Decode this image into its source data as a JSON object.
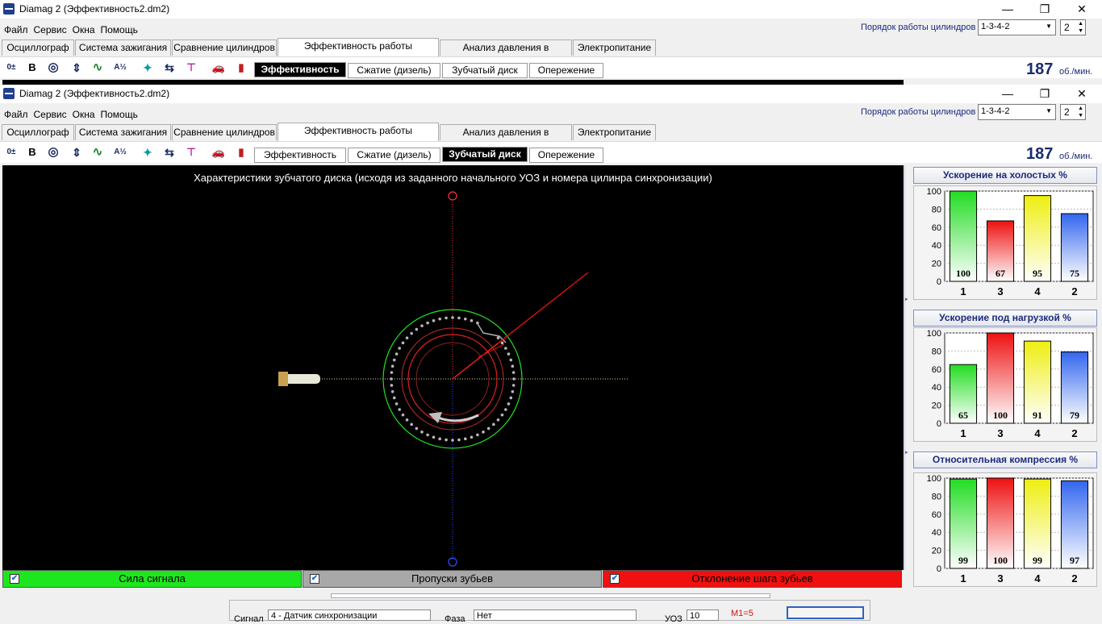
{
  "window_back": {
    "title": "Diamag 2 (Эффективность2.dm2)",
    "menu": [
      "Файл",
      "Сервис",
      "Окна",
      "Помощь"
    ],
    "cylinder_order_label": "Порядок работы цилиндров",
    "cylinder_order_value": "1-3-4-2",
    "cylinder_count": "2",
    "tabs": [
      "Осциллограф",
      "Система зажигания",
      "Сравнение цилиндров",
      "Эффективность работы цилиндров",
      "Анализ давления в цилиндре",
      "Электропитание"
    ],
    "active_tab": 3,
    "subtabs": [
      "Эффективность",
      "Сжатие (дизель)",
      "Зубчатый диск",
      "Опережение"
    ],
    "active_subtab": 0,
    "rpm": "187",
    "rpm_unit": "об./мин."
  },
  "window_front": {
    "title": "Diamag 2 (Эффективность2.dm2)",
    "menu": [
      "Файл",
      "Сервис",
      "Окна",
      "Помощь"
    ],
    "cylinder_order_label": "Порядок работы цилиндров",
    "cylinder_order_value": "1-3-4-2",
    "cylinder_count": "2",
    "tabs": [
      "Осциллограф",
      "Система зажигания",
      "Сравнение цилиндров",
      "Эффективность работы цилиндров",
      "Анализ давления в цилиндре",
      "Электропитание"
    ],
    "active_tab": 3,
    "subtabs": [
      "Эффективность",
      "Сжатие (дизель)",
      "Зубчатый диск",
      "Опережение"
    ],
    "active_subtab": 2,
    "rpm": "187",
    "rpm_unit": "об./мин."
  },
  "toolbar_icons": [
    "zero-offset-icon",
    "bold-icon",
    "rpm-gauge-icon",
    "scale-icon",
    "waveform-icon",
    "algorithm-icon",
    "sensor-icon",
    "numbering-icon",
    "filter-icon",
    "car-icon",
    "bars-icon"
  ],
  "toolbar_icon_glyphs": [
    "0±",
    "B",
    "◎",
    "⇕",
    "∿",
    "A½",
    "✦",
    "⇆",
    "⊤",
    "🚗",
    "▮"
  ],
  "canvas": {
    "title": "Характеристики зубчатого диска (исходя из заданного начального УОЗ и номера цилинра синхронизации)"
  },
  "legend": [
    {
      "label": "Сила сигнала",
      "color": "#1ee61e",
      "checked": true
    },
    {
      "label": "Пропуски зубьев",
      "color": "#a8a8a8",
      "checked": true
    },
    {
      "label": "Отклонение шага зубьев",
      "color": "#f01010",
      "checked": true
    }
  ],
  "chart_data": [
    {
      "type": "bar",
      "title": "Ускорение на холостых %",
      "categories": [
        "1",
        "3",
        "4",
        "2"
      ],
      "values": [
        100,
        67,
        95,
        75
      ],
      "colors": [
        "#22dd22",
        "#ee1111",
        "#eeee11",
        "#3366ee"
      ],
      "ylim": [
        0,
        100
      ],
      "yticks": [
        0,
        20,
        40,
        60,
        80,
        100
      ],
      "grid": true
    },
    {
      "type": "bar",
      "title": "Ускорение под нагрузкой %",
      "categories": [
        "1",
        "3",
        "4",
        "2"
      ],
      "values": [
        65,
        100,
        91,
        79
      ],
      "colors": [
        "#22dd22",
        "#ee1111",
        "#eeee11",
        "#3366ee"
      ],
      "ylim": [
        0,
        100
      ],
      "yticks": [
        0,
        20,
        40,
        60,
        80,
        100
      ],
      "grid": true
    },
    {
      "type": "bar",
      "title": "Относительная компрессия %",
      "categories": [
        "1",
        "3",
        "4",
        "2"
      ],
      "values": [
        99,
        100,
        99,
        97
      ],
      "colors": [
        "#22dd22",
        "#ee1111",
        "#eeee11",
        "#3366ee"
      ],
      "ylim": [
        0,
        100
      ],
      "yticks": [
        0,
        20,
        40,
        60,
        80,
        100
      ],
      "grid": true
    }
  ],
  "bottom": {
    "sensor_label": "Сигнал",
    "sensor_value": "4 - Датчик синхронизации",
    "phase_label": "Фаза",
    "phase_value": "Нет",
    "uoz_label": "УОЗ",
    "uoz_value": "10",
    "marker": "M1=5"
  }
}
